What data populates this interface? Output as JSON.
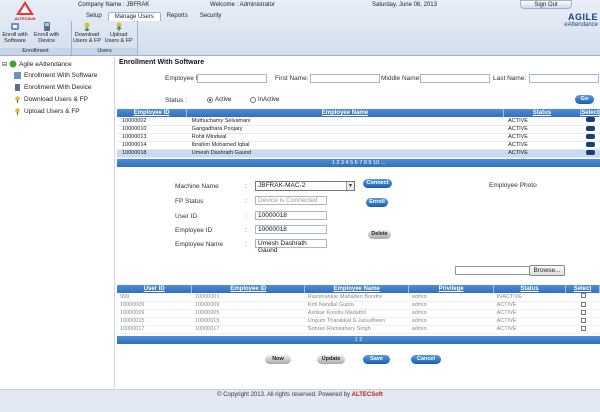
{
  "header": {
    "logo_text": "ALTECSoft",
    "company": "Company Name :  JBFRAK",
    "welcome": "Welcome :  Administrator",
    "date": "Saturday, June 08, 2013",
    "signout": "Sign Out",
    "brand_line1": "AGILE",
    "brand_line2": "eAttendance"
  },
  "tabs": [
    "Setup",
    "Manage Users",
    "Reports",
    "Security"
  ],
  "ribbon": {
    "enrollment_caption": "Enrollment",
    "users_caption": "Users",
    "buttons": [
      {
        "label1": "Enroll with",
        "label2": "Software"
      },
      {
        "label1": "Enroll with",
        "label2": "Device"
      },
      {
        "label1": "Download",
        "label2": "Users & FP"
      },
      {
        "label1": "Upload",
        "label2": "Users & FP"
      }
    ]
  },
  "sidebar": {
    "root": "Agile eAttendance",
    "items": [
      "Enrollment With Software",
      "Enrollment With Device",
      "Download Users & FP",
      "Upload Users & FP"
    ]
  },
  "main": {
    "title": "Enrollment With Software",
    "filters": {
      "employee_id_label": "Employee ID:",
      "first_name_label": "First Name:",
      "middle_name_label": "Middle Name:",
      "last_name_label": "Last Name:",
      "status_label": "Status :",
      "active_label": "Active",
      "inactive_label": "InActive",
      "go": "Go"
    },
    "grid1": {
      "headers": [
        "Employee ID",
        "Employee Name",
        "Status",
        "Select"
      ],
      "rows": [
        [
          "10000002",
          "Muthuchamy Selvamani",
          "ACTIVE"
        ],
        [
          "10000010",
          "Gangadhara Poojary",
          "ACTIVE"
        ],
        [
          "10000013",
          "Rohit Mindwal",
          "ACTIVE"
        ],
        [
          "10000014",
          "Ibrahim Mohamed Iqbal",
          "ACTIVE"
        ],
        [
          "10000018",
          "Umesh Dashrath Gaund",
          "ACTIVE"
        ]
      ],
      "pager": "1 2 3 4 5 6 7 8 9 10 ..."
    },
    "form": {
      "machine_label": "Machine Name",
      "machine_value": "JBFRAK-MAC-2",
      "fp_label": "FP Status",
      "fp_value": "Device is Connected",
      "userid_label": "User ID",
      "userid_value": "10000018",
      "empid_label": "Employee ID",
      "empid_value": "10000018",
      "empname_label": "Employee Name",
      "empname_value": "Umesh Dashrath  Gaund",
      "colon": ":",
      "connect": "Connect",
      "enroll": "Enroll",
      "delete": "Delete",
      "photo_label": "Employee Photo"
    },
    "browse": "Browse...",
    "grid2": {
      "headers": [
        "User ID",
        "Employee ID",
        "Employee Name",
        "Privilege",
        "Status",
        "Select"
      ],
      "rows": [
        [
          "999",
          "10000001",
          "Ravishankar Mahadeo Bondre",
          "admin",
          "INACTIVE"
        ],
        [
          "10000009",
          "10000009",
          "Kirti Nandlal Gupta",
          "admin",
          "ACTIVE"
        ],
        [
          "10000009",
          "10000005",
          "Ashkar Koorilu Madathil",
          "admin",
          "ACTIVE"
        ],
        [
          "10000015",
          "10000015",
          "Ungum Tharakkal S Janudheen",
          "admin",
          "ACTIVE"
        ],
        [
          "10000017",
          "10000017",
          "Sobran Ramsahary Singh",
          "admin",
          "ACTIVE"
        ]
      ],
      "pager": "1 2"
    },
    "actions": [
      "Now",
      "Update",
      "Save",
      "Cancel"
    ]
  },
  "footer": {
    "text": "© Copyright 2013. All rights reserved. Powered by ",
    "company": "ALTECSoft"
  }
}
